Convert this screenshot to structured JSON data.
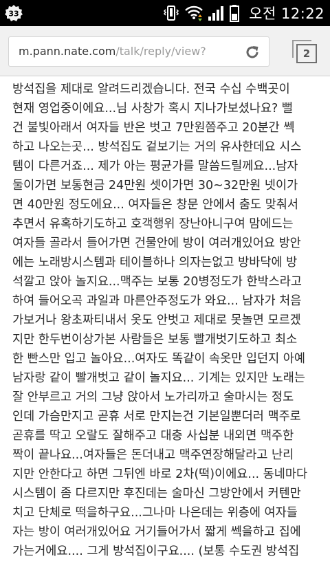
{
  "status_bar": {
    "notification_badge": "33",
    "clock": "오전 12:22",
    "icons": [
      "vibrate-icon",
      "wifi-icon",
      "signal-icon",
      "battery-icon"
    ]
  },
  "browser": {
    "url_host": "m.pann.nate.com",
    "url_path": "/talk/reply/view?",
    "tab_count": "2",
    "icons": [
      "reload-icon",
      "tabs-icon"
    ]
  },
  "article": {
    "lines": [
      "방석집을 제대로 알려드리겠습니다. 전국 수십 수백곳이",
      "현재 영업중이에요...님 사창가 혹시 지나가보셨나요? 뻘",
      "건 불빛아래서 여자들 반은 벗고 7만원쯤주고 20분간 쎅",
      "하고 나오는곳... 방석집도 겉보기는 거의 유사한데요 시스",
      "템이 다른거죠... 제가 아는 평균가를 말씀드릴께요...남자",
      "둘이가면 보통현금 24만원 셋이가면 30~32만원 넷이가",
      "면 40만원 정도에요... 여자들은 창문 안에서 춤도 맞춰서",
      "추면서 유혹하기도하고 호객행위 장난아니구여 맘에드는",
      "여자들 골라서 들어가면 건물안에 방이 여러개있어요 방안",
      "에는 노래방시스템과 테이블하나 의자는없고 방바닥에 방",
      "석깔고 앉아 놀지요...맥주는 보통 20병정도가 한박스라고",
      "하여 들어오곡 과일과 마른안주정도가 와요... 남자가 처음",
      "가보거나 왕초짜티내서 옷도 안벗고 제대로 못놀면 모르겠",
      "지만 한두번이상가본 사람들은 보통 빨개벗기도하고 최소",
      "한 빤스만 입고 놀아요...여자도 똑같이 속옷만 입던지 아예",
      "남자랑 같이 빨개벗고 같이 놀지요... 기계는 있지만 노래는",
      "잘 안부르고 거의 그냥 앉아서 노가리까고 술마시는 정도",
      "인데 가슴만지고 곧휴 서로 만지는건 기본일뿐더러 맥주로",
      "곧휴를 딱고 오랄도 잘해주고 대충 사십분 내외면 맥주한",
      "짝이 끝나요...여자들은 돈더내고 맥주연장해달라고 난리",
      "지만 안한다고 하면 그뒤엔 바로 2차(떡)이에요... 동네마다",
      "시스템이 좀 다르지만 후진데는 술마신 그방안에서 커텐만",
      "치고 단체로 떡을하구요...그나마 나은데는 위층에 여자들",
      "자는 방이 여러개있어요 거기들어가서 짧게 쎅을하고 집에",
      "가는거에요.... 그게 방석집이구요.... (보통 수도권 방석집"
    ]
  }
}
